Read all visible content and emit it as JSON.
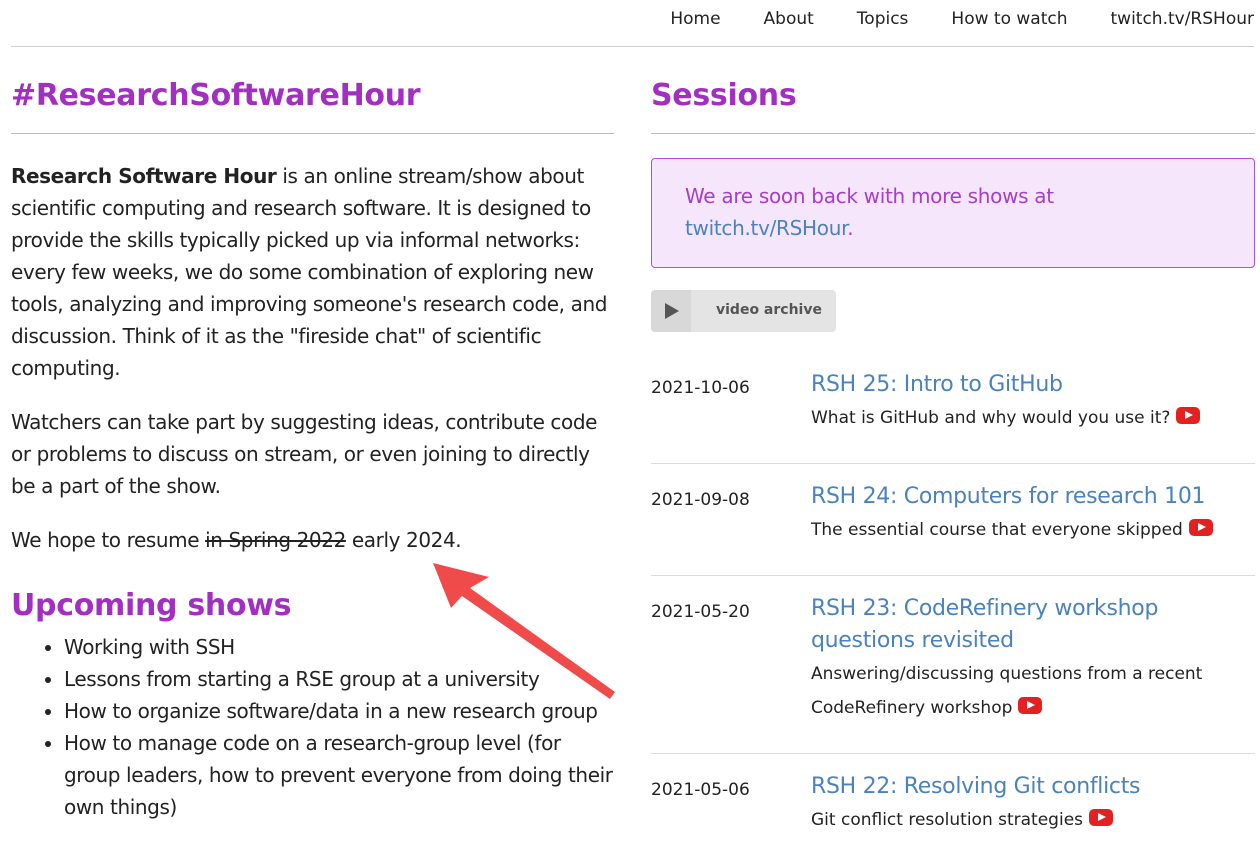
{
  "nav": {
    "items": [
      "Home",
      "About",
      "Topics",
      "How to watch",
      "twitch.tv/RSHour"
    ]
  },
  "left": {
    "title": "#ResearchSoftwareHour",
    "intro_bold": "Research Software Hour",
    "intro_rest": " is an online stream/show about scientific computing and research software. It is designed to provide the skills typically picked up via informal networks: every few weeks, we do some combination of exploring new tools, analyzing and improving someone's research code, and discussion. Think of it as the \"fireside chat\" of scientific computing.",
    "paragraph2": "Watchers can take part by suggesting ideas, contribute code or problems to discuss on stream, or even joining to directly be a part of the show.",
    "resume_prefix": "We hope to resume ",
    "resume_struck": "in Spring 2022",
    "resume_suffix": " early 2024.",
    "upcoming_title": "Upcoming shows",
    "upcoming": [
      "Working with SSH",
      "Lessons from starting a RSE group at a university",
      "How to organize software/data in a new research group",
      "How to manage code on a research-group level (for group leaders, how to prevent everyone from doing their own things)"
    ]
  },
  "right": {
    "title": "Sessions",
    "notice_text": "We are soon back with more shows at ",
    "notice_link": "twitch.tv/RSHour",
    "notice_end": ".",
    "archive_label": "video archive",
    "sessions": [
      {
        "date": "2021-10-06",
        "title": "RSH 25: Intro to GitHub",
        "desc": "What is GitHub and why would you use it?"
      },
      {
        "date": "2021-09-08",
        "title": "RSH 24: Computers for research 101",
        "desc": "The essential course that everyone skipped"
      },
      {
        "date": "2021-05-20",
        "title": "RSH 23: CodeRefinery workshop questions revisited",
        "desc": "Answering/discussing questions from a recent CodeRefinery workshop"
      },
      {
        "date": "2021-05-06",
        "title": "RSH 22: Resolving Git conflicts",
        "desc": "Git conflict resolution strategies"
      }
    ]
  },
  "colors": {
    "heading": "#a22fc2",
    "link": "#4a82bd",
    "notice_bg": "#f6e6fb",
    "arrow": "#ef4b4b",
    "youtube": "#e32121"
  },
  "icons": [
    "play-icon",
    "youtube-icon",
    "arrow-annotation"
  ]
}
